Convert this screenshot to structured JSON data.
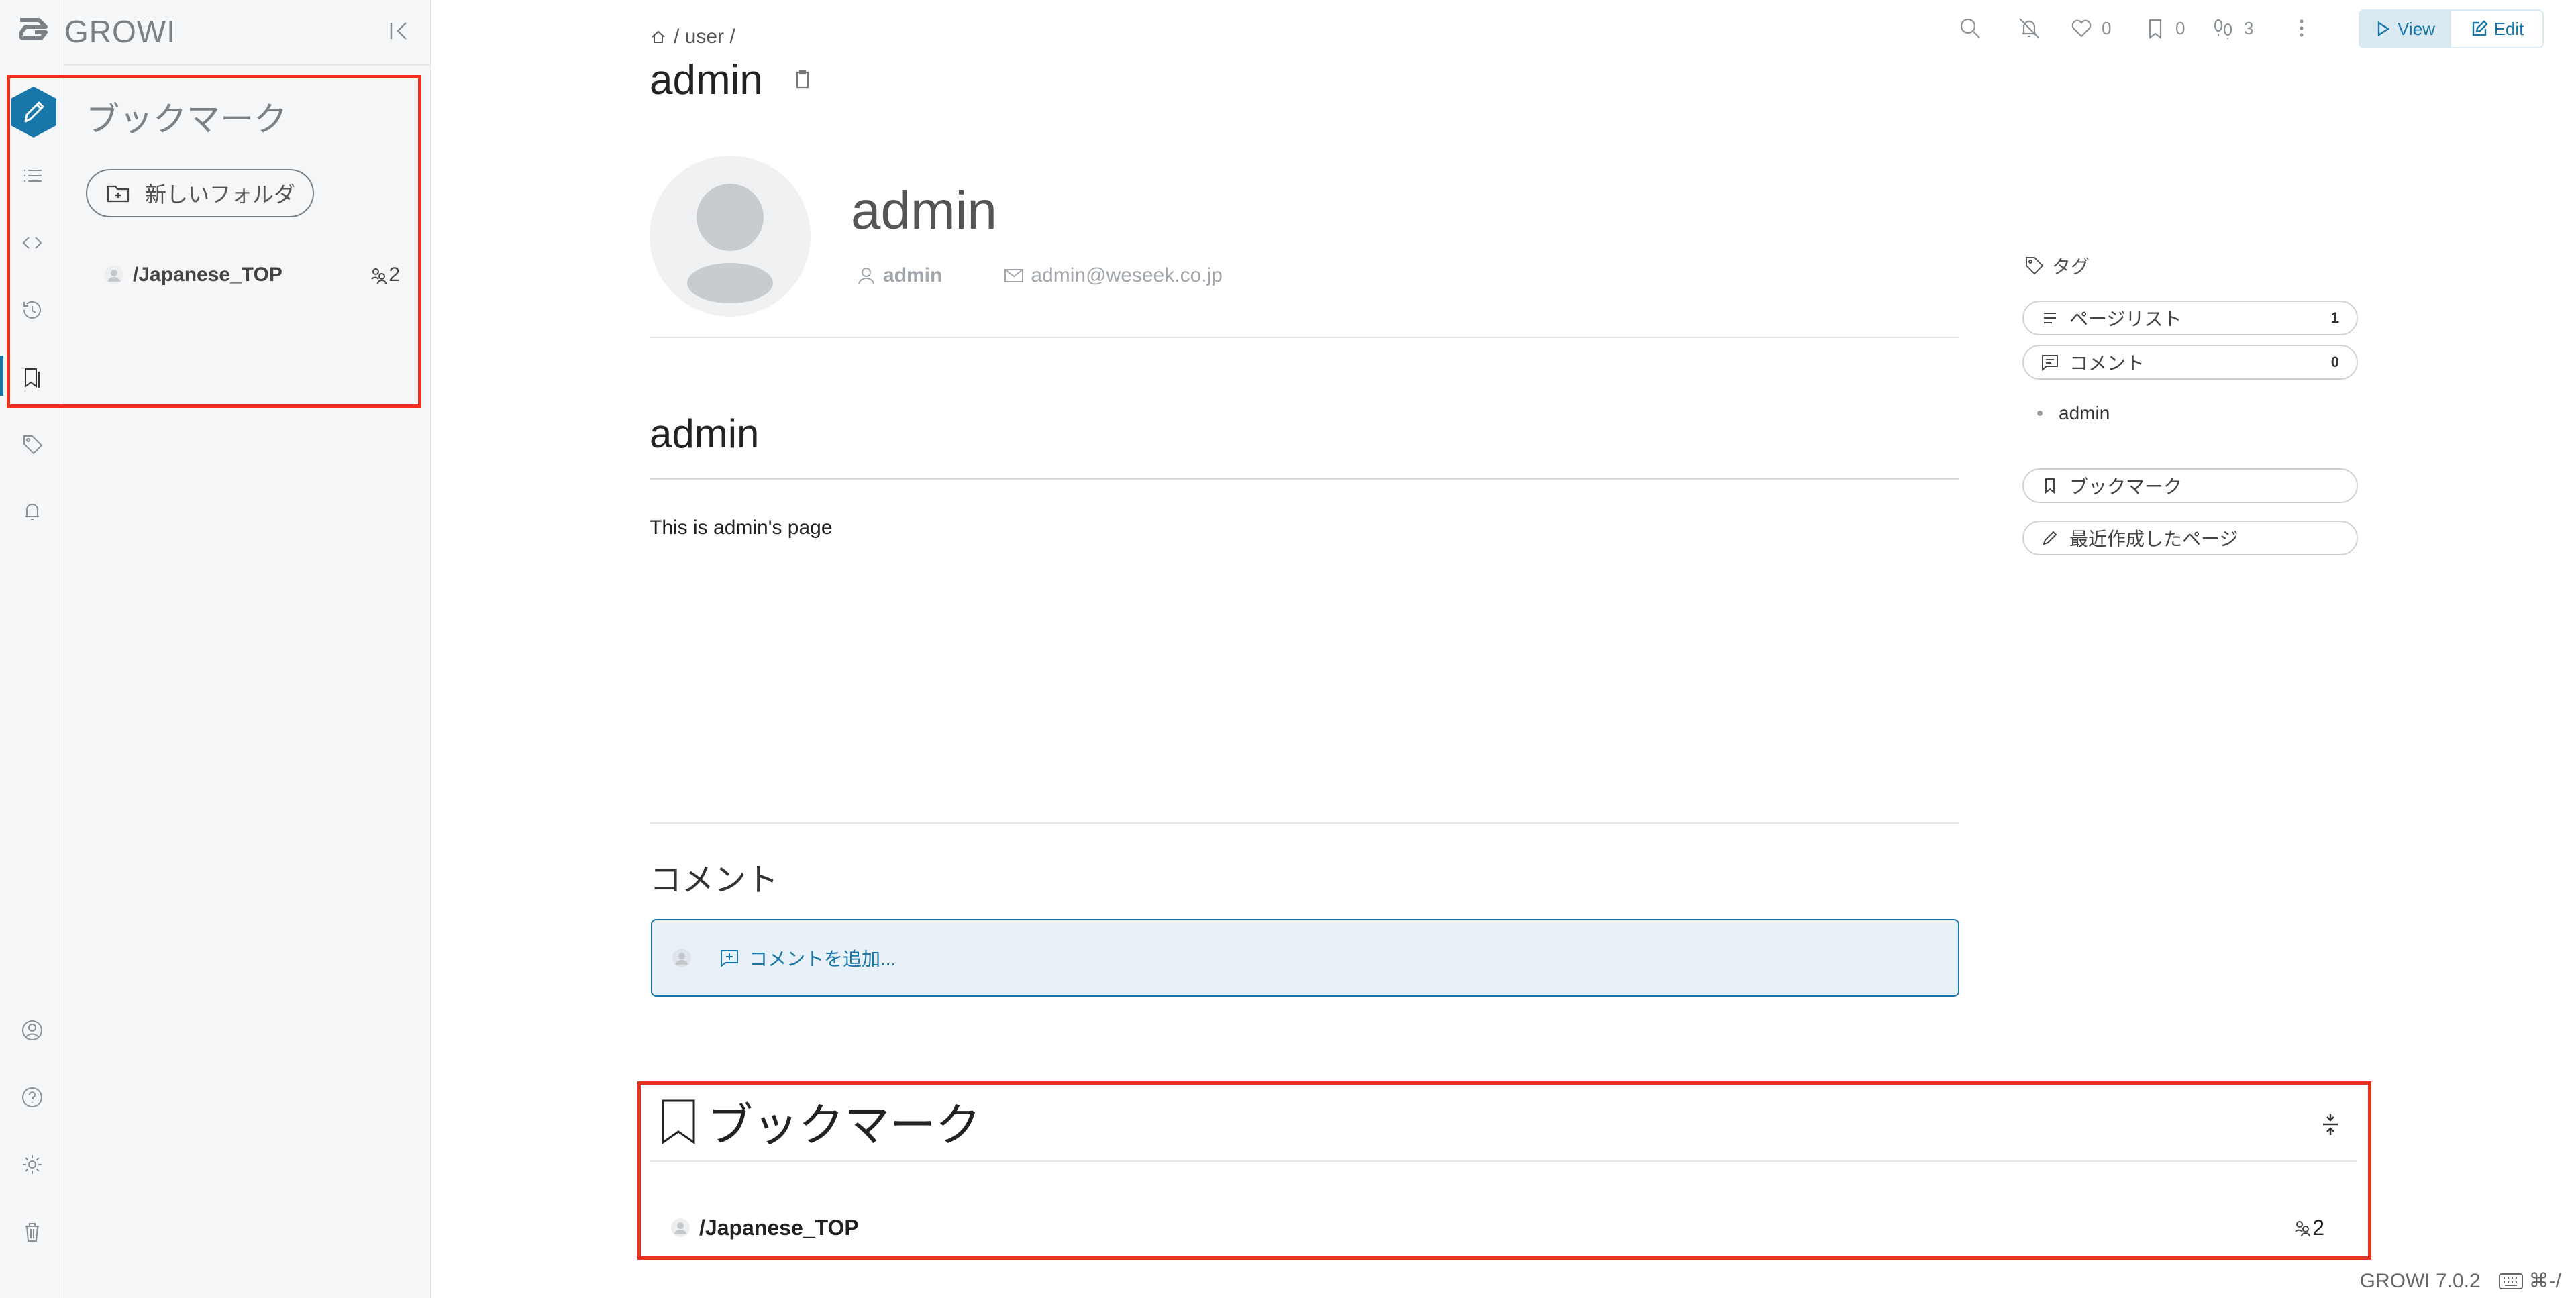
{
  "app": {
    "name": "GROWI",
    "version": "GROWI 7.0.2",
    "shortcut": "⌘-/"
  },
  "sidebar": {
    "title": "ブックマーク",
    "new_folder_label": "新しいフォルダ",
    "items": [
      {
        "path": "/Japanese_TOP",
        "count": "2"
      }
    ],
    "rail_icons": [
      "pen-icon",
      "list-icon",
      "code-icon",
      "history-icon",
      "bookmark-icon",
      "tag-icon",
      "bell-icon",
      "user-circle-icon",
      "help-icon",
      "gear-icon",
      "trash-icon"
    ]
  },
  "topbar": {
    "like_count": "0",
    "bookmark_count": "0",
    "seen_count": "3",
    "view_label": "View",
    "edit_label": "Edit"
  },
  "page": {
    "breadcrumb": "/ user /",
    "title": "admin",
    "user": {
      "name": "admin",
      "username": "admin",
      "email": "admin@weseek.co.jp"
    },
    "heading": "admin",
    "body": "This is admin's page"
  },
  "comments": {
    "title": "コメント",
    "add_label": "コメントを追加..."
  },
  "bookmarks_section": {
    "title": "ブックマーク",
    "items": [
      {
        "path": "/Japanese_TOP",
        "count": "2"
      }
    ]
  },
  "right_panel": {
    "tag_label": "タグ",
    "page_list": {
      "label": "ページリスト",
      "count": "1"
    },
    "comment": {
      "label": "コメント",
      "count": "0"
    },
    "tags": [
      "admin"
    ],
    "bookmark_link": "ブックマーク",
    "recent_link": "最近作成したページ"
  },
  "colors": {
    "accent": "#1976a8",
    "highlight_box": "#e8311f",
    "sidebar_bg": "#f5f6f7"
  }
}
